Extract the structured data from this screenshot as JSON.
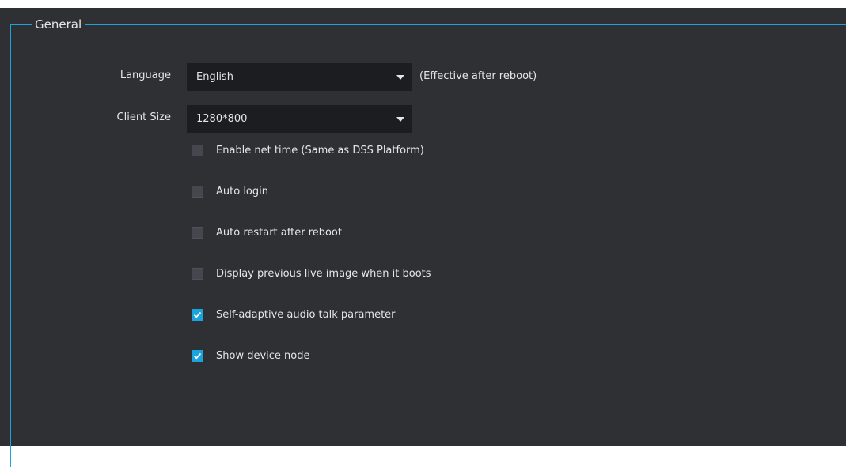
{
  "group": {
    "title": "General"
  },
  "language": {
    "label": "Language",
    "value": "English",
    "note": "(Effective after reboot)"
  },
  "client_size": {
    "label": "Client Size",
    "value": "1280*800"
  },
  "options": [
    {
      "label": "Enable net time (Same as DSS Platform)",
      "checked": false
    },
    {
      "label": "Auto login",
      "checked": false
    },
    {
      "label": "Auto restart after reboot",
      "checked": false
    },
    {
      "label": "Display previous live image when it boots",
      "checked": false
    },
    {
      "label": "Self-adaptive audio talk parameter",
      "checked": true
    },
    {
      "label": "Show device node",
      "checked": true
    }
  ],
  "colors": {
    "accent": "#1aa3dc",
    "background": "#2e3034",
    "input_background": "#1c1d20",
    "text": "#e6e6e6"
  }
}
